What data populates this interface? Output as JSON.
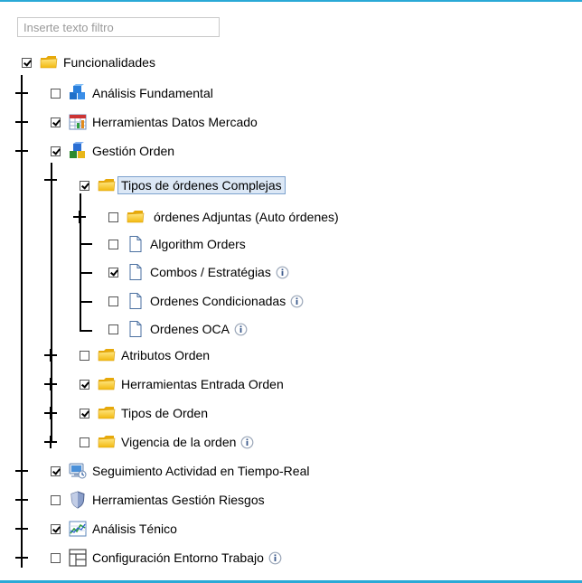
{
  "filter": {
    "placeholder": "Inserte texto filtro",
    "value": ""
  },
  "tree": {
    "root": {
      "label": "Funcionalidades",
      "checked": true,
      "icon": "folder-icon"
    },
    "nodes": [
      {
        "label": "Análisis Fundamental",
        "checked": false,
        "expander": "collapsed",
        "icon": "cubes-icon"
      },
      {
        "label": "Herramientas Datos Mercado",
        "checked": true,
        "expander": "collapsed",
        "icon": "spreadsheet-icon"
      },
      {
        "label": "Gestión Orden",
        "checked": true,
        "expander": "expanded",
        "icon": "blocks-icon"
      },
      {
        "label": "Tipos de órdenes Complejas",
        "checked": true,
        "expander": "expanded",
        "icon": "folder-icon",
        "selected": true
      },
      {
        "label": "órdenes Adjuntas (Auto órdenes)",
        "checked": false,
        "expander": "collapsed",
        "icon": "folder-icon"
      },
      {
        "label": "Algorithm Orders",
        "checked": false,
        "icon": "document-icon"
      },
      {
        "label": "Combos / Estratégias",
        "checked": true,
        "icon": "document-icon",
        "info": true
      },
      {
        "label": "Ordenes Condicionadas",
        "checked": false,
        "icon": "document-icon",
        "info": true
      },
      {
        "label": "Ordenes OCA",
        "checked": false,
        "icon": "document-icon",
        "info": true
      },
      {
        "label": "Atributos Orden",
        "checked": false,
        "expander": "collapsed",
        "icon": "folder-icon"
      },
      {
        "label": "Herramientas Entrada Orden",
        "checked": true,
        "expander": "collapsed",
        "icon": "folder-icon"
      },
      {
        "label": "Tipos de Orden",
        "checked": true,
        "expander": "collapsed",
        "icon": "folder-icon"
      },
      {
        "label": "Vigencia de la orden",
        "checked": false,
        "expander": "collapsed",
        "icon": "folder-icon",
        "info": true
      },
      {
        "label": "Seguimiento Actividad en Tiempo-Real",
        "checked": true,
        "expander": "collapsed",
        "icon": "monitor-icon"
      },
      {
        "label": "Herramientas Gestión Riesgos",
        "checked": false,
        "expander": "collapsed",
        "icon": "shield-icon"
      },
      {
        "label": "Análisis Ténico",
        "checked": true,
        "expander": "collapsed",
        "icon": "chart-icon"
      },
      {
        "label": "Configuración Entorno Trabajo",
        "checked": false,
        "expander": "collapsed",
        "icon": "layout-icon",
        "info": true
      }
    ]
  },
  "colors": {
    "accent": "#2aa9d6",
    "selection": "#dce8f6",
    "selection_border": "#7da2ce",
    "folder": "#f5c842"
  }
}
